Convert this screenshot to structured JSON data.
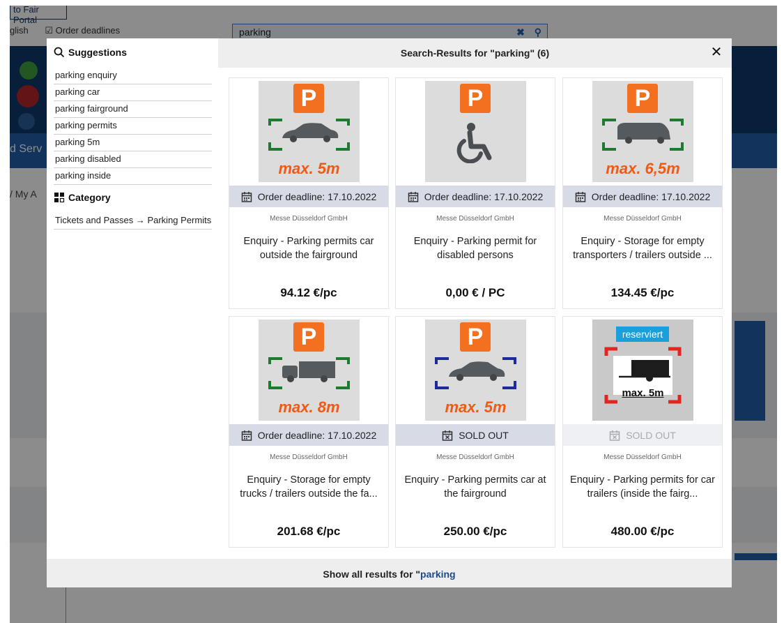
{
  "background": {
    "top_button": "to Fair Portal",
    "language": "glish",
    "order_deadlines": "Order deadlines",
    "search_value": "parking",
    "nav_text": "d   Serv",
    "breadcrumb": "/  My A"
  },
  "sidebar": {
    "suggestions_heading": "Suggestions",
    "suggestions": [
      "parking enquiry",
      "parking car",
      "parking fairground",
      "parking permits",
      "parking 5m",
      "parking disabled",
      "parking inside"
    ],
    "category_heading": "Category",
    "category_link": "Tickets and Passes → Parking Permits"
  },
  "header": {
    "title": "Search-Results for \"parking\" (6)",
    "close_glyph": "✕"
  },
  "results": [
    {
      "status": "Order deadline: 17.10.2022",
      "vendor": "Messe Düsseldorf GmbH",
      "title": "Enquiry - Parking permits car outside the fairground",
      "price": "94.12 €/pc",
      "image_label": "max. 5m",
      "image_icon": "car-icon"
    },
    {
      "status": "Order deadline: 17.10.2022",
      "vendor": "Messe Düsseldorf GmbH",
      "title": "Enquiry - Parking permit for disabled persons",
      "price": "0,00 € / PC",
      "image_label": "",
      "image_icon": "wheelchair-icon"
    },
    {
      "status": "Order deadline: 17.10.2022",
      "vendor": "Messe Düsseldorf GmbH",
      "title": "Enquiry - Storage for empty transporters / trailers outside ...",
      "price": "134.45 €/pc",
      "image_label": "max. 6,5m",
      "image_icon": "van-icon"
    },
    {
      "status": "Order deadline: 17.10.2022",
      "vendor": "Messe Düsseldorf GmbH",
      "title": "Enquiry - Storage for empty trucks / trailers outside the fa...",
      "price": "201.68 €/pc",
      "image_label": "max. 8m",
      "image_icon": "truck-icon"
    },
    {
      "status": "SOLD OUT",
      "vendor": "Messe Düsseldorf GmbH",
      "title": "Enquiry - Parking permits car at the fairground",
      "price": "250.00 €/pc",
      "image_label": "max. 5m",
      "image_icon": "car-icon"
    },
    {
      "status": "SOLD OUT",
      "vendor": "Messe Düsseldorf GmbH",
      "title": "Enquiry - Parking permits for car trailers (inside the fairg...",
      "price": "480.00 €/pc",
      "image_label": "max. 5m",
      "image_badge": "reserviert",
      "image_icon": "trailer-icon"
    }
  ],
  "p_letter": "P",
  "footer": {
    "prefix": "Show all results for \"",
    "query": "parking"
  },
  "colors": {
    "accent": "#1f5ea8",
    "parking_orange": "#f37021",
    "frame_green": "#1e7a2e",
    "frame_blue": "#1f2a9a",
    "frame_red": "#e2261f",
    "badge_blue": "#19a0dc"
  }
}
